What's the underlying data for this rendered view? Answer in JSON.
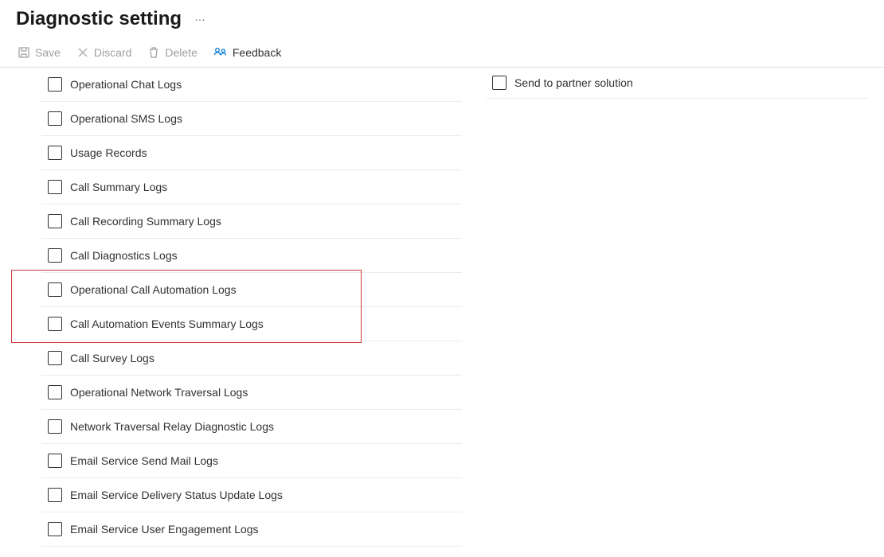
{
  "header": {
    "title": "Diagnostic setting",
    "more": "…"
  },
  "toolbar": {
    "save_label": "Save",
    "discard_label": "Discard",
    "delete_label": "Delete",
    "feedback_label": "Feedback"
  },
  "logs": [
    {
      "label": "Operational Chat Logs",
      "checked": false
    },
    {
      "label": "Operational SMS Logs",
      "checked": false
    },
    {
      "label": "Usage Records",
      "checked": false
    },
    {
      "label": "Call Summary Logs",
      "checked": false
    },
    {
      "label": "Call Recording Summary Logs",
      "checked": false
    },
    {
      "label": "Call Diagnostics Logs",
      "checked": false
    },
    {
      "label": "Operational Call Automation Logs",
      "checked": false
    },
    {
      "label": "Call Automation Events Summary Logs",
      "checked": false
    },
    {
      "label": "Call Survey Logs",
      "checked": false
    },
    {
      "label": "Operational Network Traversal Logs",
      "checked": false
    },
    {
      "label": "Network Traversal Relay Diagnostic Logs",
      "checked": false
    },
    {
      "label": "Email Service Send Mail Logs",
      "checked": false
    },
    {
      "label": "Email Service Delivery Status Update Logs",
      "checked": false
    },
    {
      "label": "Email Service User Engagement Logs",
      "checked": false
    }
  ],
  "destinations": [
    {
      "label": "Send to partner solution",
      "checked": false
    }
  ],
  "highlight": {
    "start_index": 6,
    "end_index": 7
  }
}
